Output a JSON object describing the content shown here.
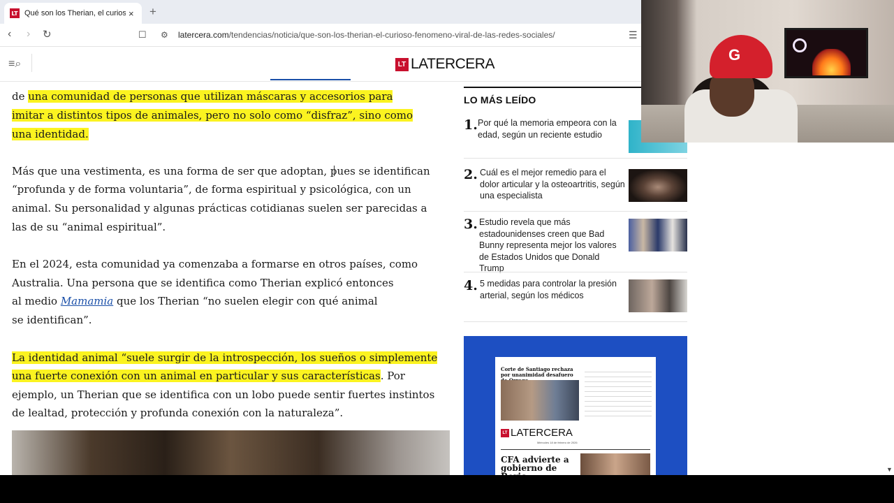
{
  "browser": {
    "tab_title": "Qué son los Therian, el curioso fenómeno viral de las redes sociales",
    "tab_close": "×",
    "new_tab": "+",
    "url_domain": "latercera.com",
    "url_path": "/tendencias/noticia/que-son-los-therian-el-curioso-fenomeno-viral-de-las-redes-sociales/",
    "favicon_text": "LT"
  },
  "site": {
    "logo_box": "LT",
    "logo_text": "LATERCERA"
  },
  "article": {
    "p1_l1_a": "de ",
    "p1_l1_b": "una comunidad de personas que utilizan máscaras y accesorios para",
    "p1_l2": "imitar a distintos tipos de animales, pero no solo como “disfraz”, sino como",
    "p1_l3": "una identidad.",
    "p2_l1": "Más que una vestimenta, es una forma de ser que adoptan, pues se identifican",
    "p2_l2": "“profunda y de forma voluntaria”, de forma espiritual y psicológica, con un",
    "p2_l3": "animal. Su personalidad y algunas prácticas cotidianas suelen ser parecidas a",
    "p2_l4": "las de su “animal espiritual”.",
    "p3_l1": "En el 2024, esta comunidad ya comenzaba a formarse en otros países, como",
    "p3_l2": "Australia. Una persona que se identifica como Therian explicó entonces",
    "p3_l3_a": "al medio ",
    "p3_l3_link": "Mamamia",
    "p3_l3_b": " que los Therian “no suelen elegir con qué animal",
    "p3_l4": "se identifican”.",
    "p4_l1": "La identidad animal “suele surgir de la introspección, los sueños o simplemente",
    "p4_l2_hl": "una fuerte conexión con un animal en particular y sus características",
    "p4_l2_b": ". Por",
    "p4_l3": "ejemplo, un Therian que se identifica con un lobo puede sentir fuertes instintos",
    "p4_l4": "de lealtad, protección y profunda conexión con la naturaleza”."
  },
  "sidebar": {
    "title": "LO MÁS LEÍDO",
    "items": [
      {
        "num": "1.",
        "text": "Por qué la memoria empeora con la edad, según un reciente estudio"
      },
      {
        "num": "2.",
        "text": "Cuál es el mejor remedio para el dolor articular y la osteoartritis, según una especialista"
      },
      {
        "num": "3.",
        "text": "Estudio revela que más estadounidenses creen que Bad Bunny representa mejor los valores de Estados Unidos que Donald Trump"
      },
      {
        "num": "4.",
        "text": "5 medidas para controlar la presión arterial, según los médicos"
      }
    ]
  },
  "ad": {
    "headline1": "Corte de Santiago rechaza por unanimidad desafuero de Orrego",
    "logo_box": "LT",
    "logo_text": "LATERCERA",
    "date": "Miércoles 18 de febrero de 2026",
    "headline2": "CFA advierte a gobierno de Boric"
  },
  "webcam": {
    "cap_logo": "G"
  }
}
